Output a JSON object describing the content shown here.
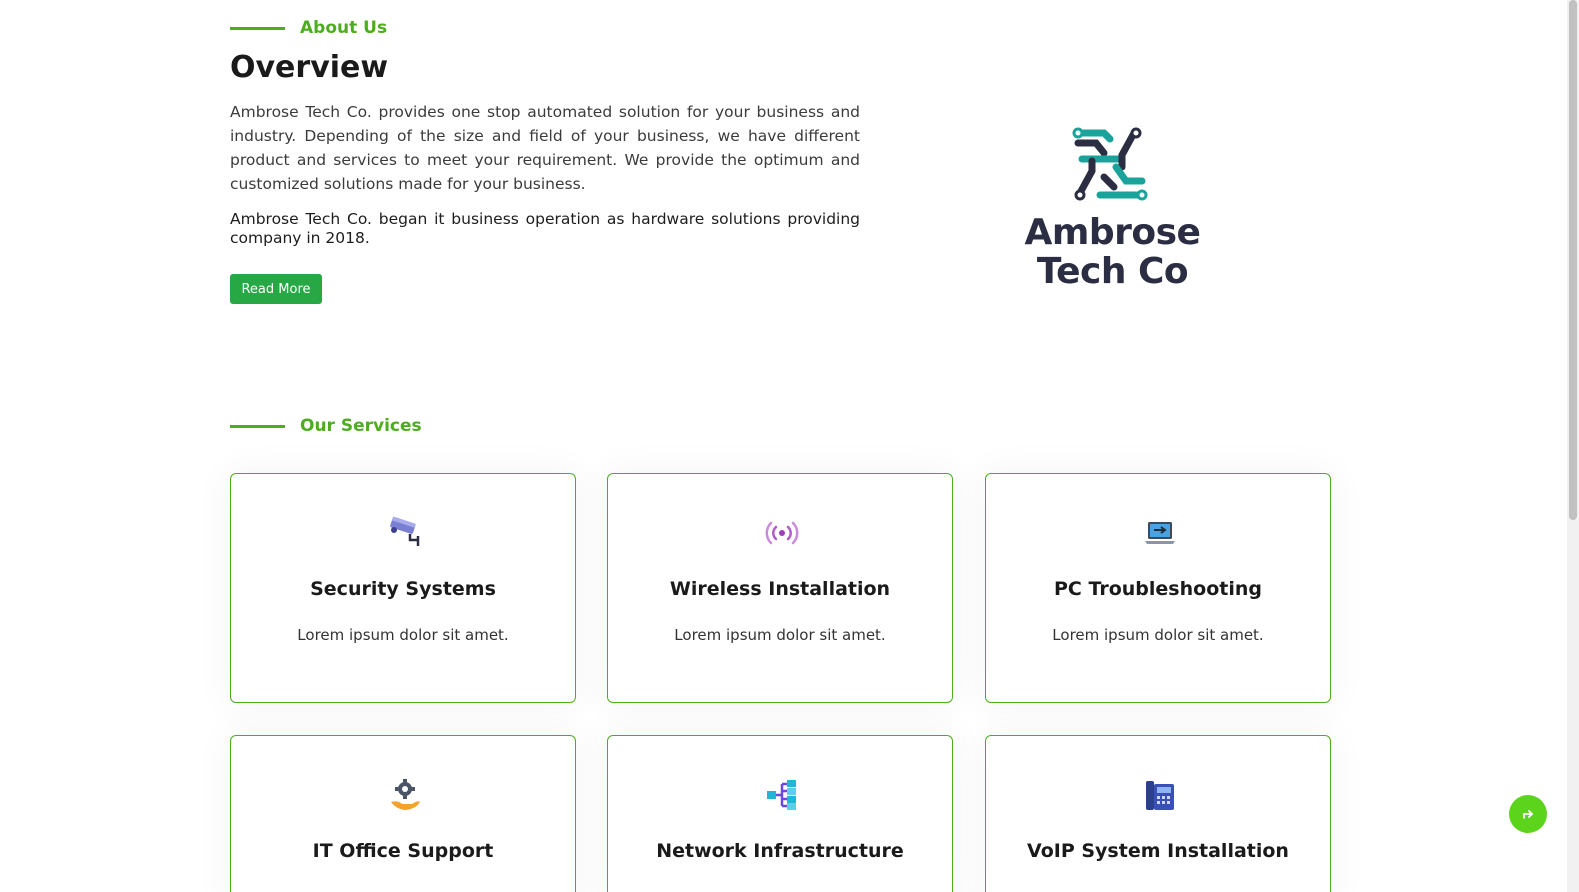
{
  "about": {
    "label": "About Us",
    "title": "Overview",
    "paragraph1": "Ambrose Tech Co. provides one stop automated solution for your business and industry. Depending of the size and field of your business, we have different product and services to meet your requirement. We provide the optimum and customized solutions made for your business.",
    "paragraph2": "Ambrose Tech Co. began it business operation as hardware solutions providing company in 2018.",
    "button": "Read More"
  },
  "logo": {
    "line1": "Ambrose",
    "line2": "Tech Co"
  },
  "services": {
    "label": "Our Services",
    "items": [
      {
        "title": "Security Systems",
        "desc": "Lorem ipsum dolor sit amet.",
        "icon": "cctv-camera-icon"
      },
      {
        "title": "Wireless Installation",
        "desc": "Lorem ipsum dolor sit amet.",
        "icon": "wireless-signal-icon"
      },
      {
        "title": "PC Troubleshooting",
        "desc": "Lorem ipsum dolor sit amet.",
        "icon": "laptop-repair-icon"
      },
      {
        "title": "IT Office Support",
        "desc": "",
        "icon": "gear-hand-icon"
      },
      {
        "title": "Network Infrastructure",
        "desc": "",
        "icon": "network-tree-icon"
      },
      {
        "title": "VoIP System Installation",
        "desc": "",
        "icon": "desk-phone-icon"
      }
    ]
  },
  "colors": {
    "accent": "#4cae1f",
    "button": "#28a745",
    "back_to_top": "#5cd41c",
    "logo_teal": "#1aa39a",
    "logo_dark": "#2b2d42"
  }
}
